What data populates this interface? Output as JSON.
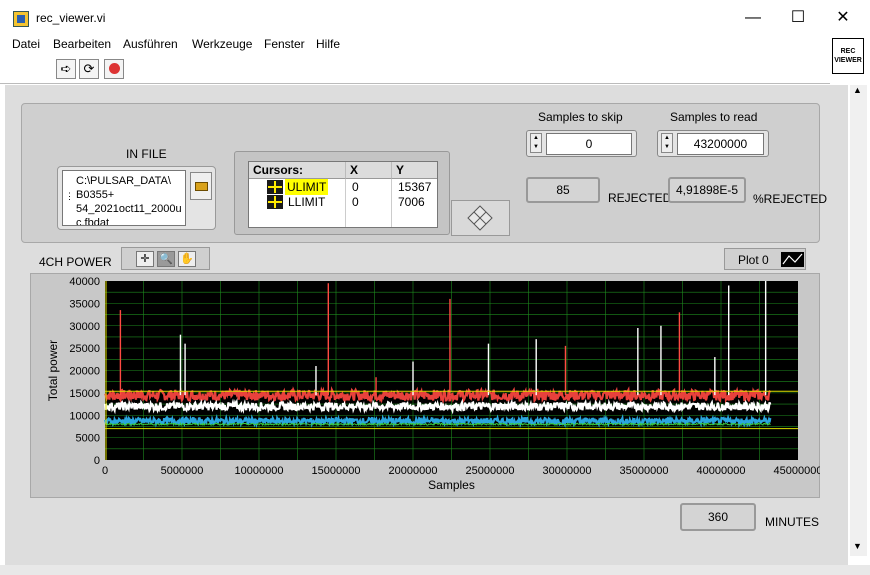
{
  "window": {
    "title": "rec_viewer.vi",
    "minimize": "—",
    "maximize": "☐",
    "close": "✕"
  },
  "menu": [
    "Datei",
    "Bearbeiten",
    "Ausführen",
    "Werkzeuge",
    "Fenster",
    "Hilfe"
  ],
  "vi_icon_text": "REC\nVIEWER",
  "in_file": {
    "label": "IN FILE",
    "path": "C:\\PULSAR_DATA\\\nB0355+\n54_2021oct11_2000u\nc.fbdat"
  },
  "samples_to_skip": {
    "label": "Samples to skip",
    "value": "0"
  },
  "samples_to_read": {
    "label": "Samples to read",
    "value": "43200000"
  },
  "rejected": {
    "value": "85",
    "label": "REJECTED"
  },
  "percent_rejected": {
    "value": "4,91898E-5",
    "label": "%REJECTED"
  },
  "cursors": {
    "headers": [
      "Cursors:",
      "X",
      "Y"
    ],
    "rows": [
      {
        "name": "ULIMIT",
        "x": "0",
        "y": "15367",
        "highlight": "#ffff00"
      },
      {
        "name": "LLIMIT",
        "x": "0",
        "y": "7006"
      }
    ]
  },
  "graph": {
    "label": "4CH POWER",
    "plot_legend": "Plot 0",
    "minutes_value": "360",
    "minutes_label": "MINUTES"
  },
  "chart_data": {
    "type": "line",
    "xlabel": "Samples",
    "ylabel": "Total power",
    "xlim": [
      0,
      45000000
    ],
    "ylim": [
      0,
      40000
    ],
    "xticks": [
      "0",
      "5000000",
      "10000000",
      "15000000",
      "20000000",
      "25000000",
      "30000000",
      "35000000",
      "40000000",
      "45000000"
    ],
    "yticks": [
      "0",
      "5000",
      "10000",
      "15000",
      "20000",
      "25000",
      "30000",
      "35000",
      "40000"
    ],
    "grid": true,
    "background": "#000000",
    "grid_color": "#1e8a1e",
    "data_end_x": 43200000,
    "cursor_lines": [
      {
        "name": "ULIMIT",
        "y": 15367,
        "color": "#e0e000"
      },
      {
        "name": "LLIMIT",
        "y": 7006,
        "color": "#e0e000"
      }
    ],
    "series": [
      {
        "color": "#e8413c",
        "level": 14500,
        "noise": 1200
      },
      {
        "color": "#ffffff",
        "level": 12000,
        "noise": 900
      },
      {
        "color": "#2ba6de",
        "level": 8700,
        "noise": 700
      },
      {
        "color": "#3acc3a",
        "level": 8000,
        "noise": 200
      }
    ],
    "spikes": [
      {
        "x": 1000000,
        "y": 33500
      },
      {
        "x": 4900000,
        "y": 28000
      },
      {
        "x": 5200000,
        "y": 26000
      },
      {
        "x": 14500000,
        "y": 39500
      },
      {
        "x": 13700000,
        "y": 21000
      },
      {
        "x": 20000000,
        "y": 22000
      },
      {
        "x": 22400000,
        "y": 36000
      },
      {
        "x": 24900000,
        "y": 26000
      },
      {
        "x": 28000000,
        "y": 27000
      },
      {
        "x": 29900000,
        "y": 25500
      },
      {
        "x": 34600000,
        "y": 29500
      },
      {
        "x": 36100000,
        "y": 30000
      },
      {
        "x": 37300000,
        "y": 33000
      },
      {
        "x": 40500000,
        "y": 39000
      },
      {
        "x": 42900000,
        "y": 40000
      },
      {
        "x": 17600000,
        "y": 18500
      },
      {
        "x": 39600000,
        "y": 23000
      }
    ]
  }
}
